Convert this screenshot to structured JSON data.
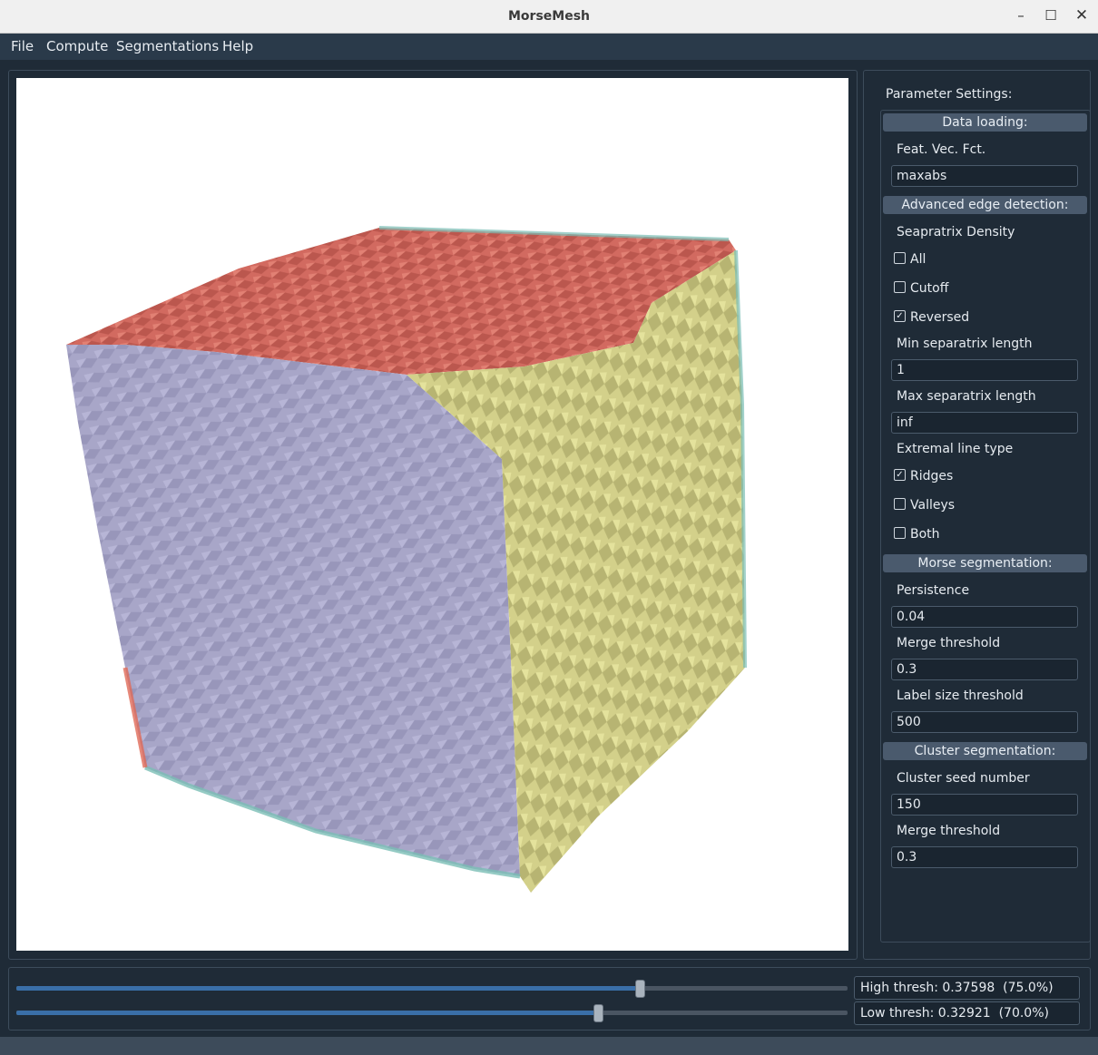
{
  "window": {
    "title": "MorseMesh",
    "minimize": "–",
    "maximize": "☐",
    "close": "✕"
  },
  "menu": {
    "file": "File",
    "compute": "Compute",
    "segmentations": "Segmentations",
    "help": "Help"
  },
  "colors": {
    "top_face": "#d9685f",
    "left_face": "#a9a7c9",
    "right_face": "#d7d48a",
    "edge_teal": "#7bbeb5"
  },
  "panel": {
    "title": "Parameter Settings:",
    "data_loading": {
      "header": "Data loading:",
      "feat_vec_label": "Feat. Vec. Fct.",
      "feat_vec_value": "maxabs"
    },
    "advanced": {
      "header": "Advanced edge detection:",
      "density_label": "Seapratrix Density",
      "all_label": "All",
      "all_checked": false,
      "cutoff_label": "Cutoff",
      "cutoff_checked": false,
      "reversed_label": "Reversed",
      "reversed_checked": true,
      "min_len_label": "Min separatrix length",
      "min_len_value": "1",
      "max_len_label": "Max separatrix length",
      "max_len_value": "inf",
      "line_type_label": "Extremal line type",
      "ridges_label": "Ridges",
      "ridges_checked": true,
      "valleys_label": "Valleys",
      "valleys_checked": false,
      "both_label": "Both",
      "both_checked": false
    },
    "morse": {
      "header": "Morse segmentation:",
      "persistence_label": "Persistence",
      "persistence_value": "0.04",
      "merge_label": "Merge threshold",
      "merge_value": "0.3",
      "label_size_label": "Label size threshold",
      "label_size_value": "500"
    },
    "cluster": {
      "header": "Cluster segmentation:",
      "seed_label": "Cluster seed number",
      "seed_value": "150",
      "merge_label": "Merge threshold",
      "merge_value": "0.3"
    }
  },
  "sliders": {
    "high": {
      "label": "High thresh: 0.37598  (75.0%)",
      "fraction": 0.75
    },
    "low": {
      "label": "Low thresh: 0.32921  (70.0%)",
      "fraction": 0.7
    }
  }
}
